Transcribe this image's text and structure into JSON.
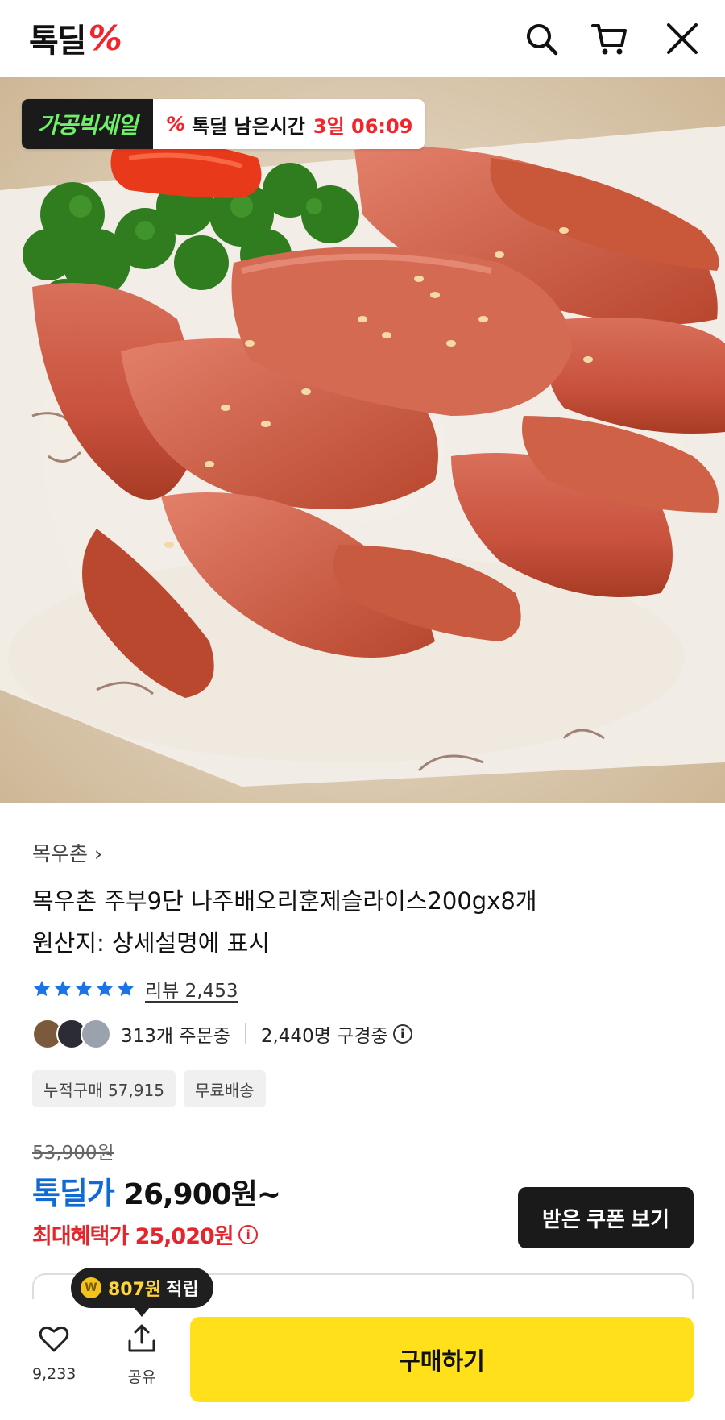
{
  "header": {
    "logo_text": "톡딜",
    "logo_mark": "%",
    "icons": [
      "search-icon",
      "cart-icon",
      "close-icon"
    ]
  },
  "hero": {
    "badge_left": "가공빅세일",
    "badge_prefix": "톡딜 남은시간",
    "badge_time": "3일 06:09",
    "badge_mark": "%"
  },
  "product": {
    "brand": "목우촌 ›",
    "title_line1": "목우촌 주부9단 나주배오리훈제슬라이스200gx8개",
    "title_line2": "원산지: 상세설명에 표시",
    "rating_stars": 5,
    "review_label": "리뷰 2,453",
    "orders": "313개 주문중",
    "watchers": "2,440명 구경중",
    "chips": [
      "누적구매 57,915",
      "무료배송"
    ]
  },
  "price": {
    "original": "53,900원",
    "deal_label": "톡딜가",
    "deal_value": "26,900원~",
    "max_label": "최대혜택가 25,020원",
    "coupon_button": "받은 쿠폰 보기"
  },
  "tooltip": {
    "coin": "W",
    "amount": "807원",
    "suffix": "적립"
  },
  "bottom": {
    "like_count": "9,233",
    "share_label": "공유",
    "buy_label": "구매하기"
  },
  "colors": {
    "brand_red": "#f1252b",
    "deal_blue": "#1169d4",
    "buy_yellow": "#ffe01a",
    "star_blue": "#1a73e8"
  }
}
